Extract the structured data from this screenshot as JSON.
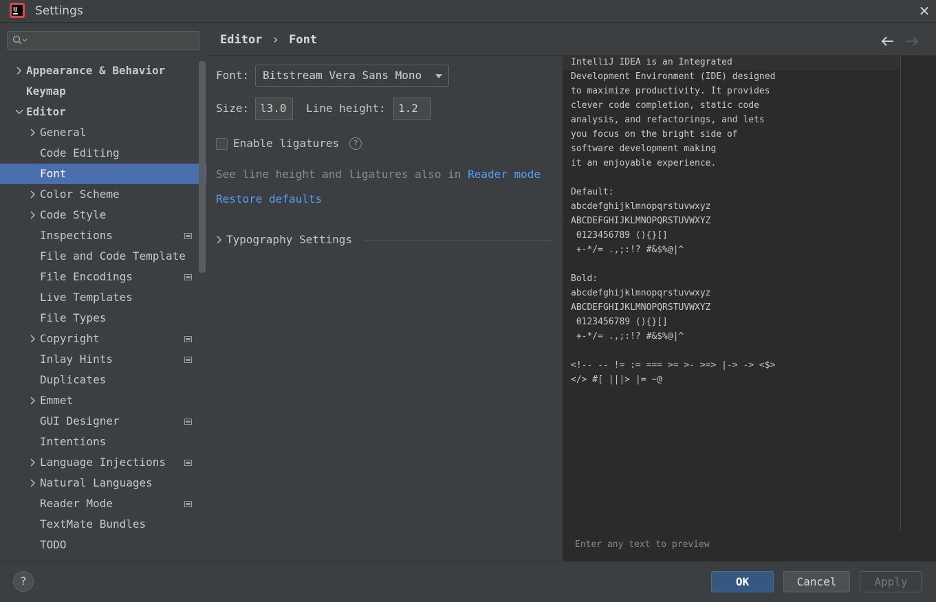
{
  "window": {
    "title": "Settings"
  },
  "search": {
    "placeholder": ""
  },
  "tree": [
    {
      "label": "Appearance & Behavior",
      "level": 0,
      "expandable": true,
      "bold": true
    },
    {
      "label": "Keymap",
      "level": 0,
      "expandable": false,
      "bold": true
    },
    {
      "label": "Editor",
      "level": 0,
      "expandable": true,
      "expanded": true,
      "bold": true
    },
    {
      "label": "General",
      "level": 1,
      "expandable": true
    },
    {
      "label": "Code Editing",
      "level": 1,
      "expandable": false
    },
    {
      "label": "Font",
      "level": 1,
      "expandable": false,
      "selected": true
    },
    {
      "label": "Color Scheme",
      "level": 1,
      "expandable": true
    },
    {
      "label": "Code Style",
      "level": 1,
      "expandable": true
    },
    {
      "label": "Inspections",
      "level": 1,
      "expandable": false,
      "badge": true
    },
    {
      "label": "File and Code Template",
      "level": 1,
      "expandable": false
    },
    {
      "label": "File Encodings",
      "level": 1,
      "expandable": false,
      "badge": true
    },
    {
      "label": "Live Templates",
      "level": 1,
      "expandable": false
    },
    {
      "label": "File Types",
      "level": 1,
      "expandable": false
    },
    {
      "label": "Copyright",
      "level": 1,
      "expandable": true,
      "badge": true
    },
    {
      "label": "Inlay Hints",
      "level": 1,
      "expandable": false,
      "badge": true
    },
    {
      "label": "Duplicates",
      "level": 1,
      "expandable": false
    },
    {
      "label": "Emmet",
      "level": 1,
      "expandable": true
    },
    {
      "label": "GUI Designer",
      "level": 1,
      "expandable": false,
      "badge": true
    },
    {
      "label": "Intentions",
      "level": 1,
      "expandable": false
    },
    {
      "label": "Language Injections",
      "level": 1,
      "expandable": true,
      "badge": true
    },
    {
      "label": "Natural Languages",
      "level": 1,
      "expandable": true
    },
    {
      "label": "Reader Mode",
      "level": 1,
      "expandable": false,
      "badge": true
    },
    {
      "label": "TextMate Bundles",
      "level": 1,
      "expandable": false
    },
    {
      "label": "TODO",
      "level": 1,
      "expandable": false
    }
  ],
  "breadcrumb": {
    "parent": "Editor",
    "separator": "›",
    "current": "Font"
  },
  "form": {
    "font_label": "Font:",
    "font_value": "Bitstream Vera Sans Mono",
    "size_label": "Size:",
    "size_value": "l3.0",
    "line_height_label": "Line height:",
    "line_height_value": "1.2",
    "ligatures_label": "Enable ligatures",
    "ligatures_checked": false,
    "hint_text": "See line height and ligatures also in",
    "hint_link": "Reader mode",
    "restore_link": "Restore defaults",
    "typography_label": "Typography Settings"
  },
  "preview": {
    "lines": [
      "IntelliJ IDEA is an Integrated",
      "Development Environment (IDE) designed",
      "to maximize productivity. It provides",
      "clever code completion, static code",
      "analysis, and refactorings, and lets",
      "you focus on the bright side of",
      "software development making",
      "it an enjoyable experience.",
      "",
      "Default:",
      "abcdefghijklmnopqrstuvwxyz",
      "ABCDEFGHIJKLMNOPQRSTUVWXYZ",
      " 0123456789 (){}[]",
      " +-*/= .,;:!? #&$%@|^",
      "",
      "Bold:",
      "abcdefghijklmnopqrstuvwxyz",
      "ABCDEFGHIJKLMNOPQRSTUVWXYZ",
      " 0123456789 (){}[]",
      " +-*/= .,;:!? #&$%@|^",
      "",
      "<!-- -- != := === >= >- >=> |-> -> <$>",
      "</> #[ |||> |= ~@"
    ],
    "placeholder": "Enter any text to preview"
  },
  "footer": {
    "help": "?",
    "ok": "OK",
    "cancel": "Cancel",
    "apply": "Apply"
  },
  "colors": {
    "accent": "#4b6eaf",
    "link": "#589df6",
    "ok_button": "#365880"
  }
}
